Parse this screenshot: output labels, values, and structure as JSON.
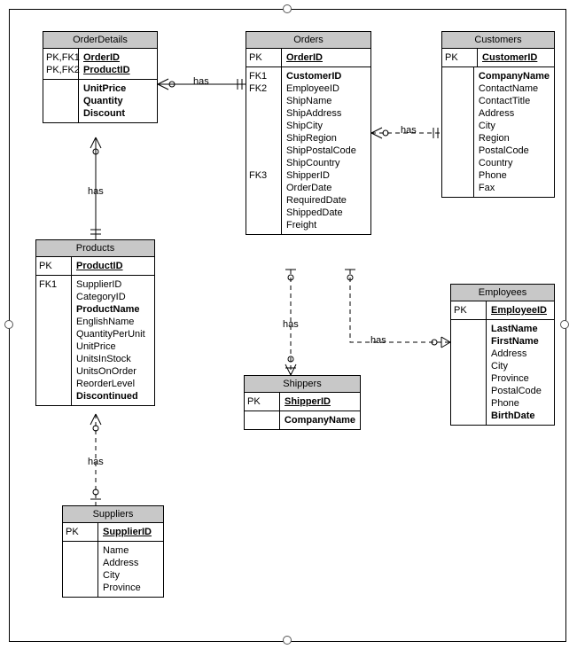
{
  "diagram": {
    "entities": {
      "orderDetails": {
        "title": "OrderDetails",
        "pk": [
          {
            "key": "PK,FK1",
            "attr": "OrderID"
          },
          {
            "key": "PK,FK2",
            "attr": "ProductID"
          }
        ],
        "body": [
          {
            "key": "",
            "attrs": [
              "UnitPrice",
              "Quantity",
              "Discount"
            ],
            "bold": [
              true,
              true,
              true
            ]
          }
        ]
      },
      "orders": {
        "title": "Orders",
        "pk": [
          {
            "key": "PK",
            "attr": "OrderID"
          }
        ],
        "body": [
          {
            "keys": [
              "FK1",
              "FK2",
              "",
              "",
              "",
              "",
              "",
              "",
              "FK3",
              "",
              "",
              "",
              ""
            ],
            "attrs": [
              "CustomerID",
              "EmployeeID",
              "ShipName",
              "ShipAddress",
              "ShipCity",
              "ShipRegion",
              "ShipPostalCode",
              "ShipCountry",
              "ShipperID",
              "OrderDate",
              "RequiredDate",
              "ShippedDate",
              "Freight"
            ],
            "bold": [
              true,
              false,
              false,
              false,
              false,
              false,
              false,
              false,
              false,
              false,
              false,
              false,
              false
            ]
          }
        ]
      },
      "customers": {
        "title": "Customers",
        "pk": [
          {
            "key": "PK",
            "attr": "CustomerID"
          }
        ],
        "body": [
          {
            "keys": [
              "",
              "",
              "",
              "",
              "",
              "",
              "",
              "",
              ""
            ],
            "attrs": [
              "CompanyName",
              "ContactName",
              "ContactTitle",
              "Address",
              "City",
              "Region",
              "PostalCode",
              "Country",
              "Phone",
              "Fax"
            ],
            "bold": [
              true,
              false,
              false,
              false,
              false,
              false,
              false,
              false,
              false,
              false
            ]
          }
        ]
      },
      "products": {
        "title": "Products",
        "pk": [
          {
            "key": "PK",
            "attr": "ProductID"
          }
        ],
        "body": [
          {
            "keys": [
              "FK1",
              "",
              "",
              "",
              "",
              "",
              "",
              "",
              "",
              ""
            ],
            "attrs": [
              "SupplierID",
              "CategoryID",
              "ProductName",
              "EnglishName",
              "QuantityPerUnit",
              "UnitPrice",
              "UnitsInStock",
              "UnitsOnOrder",
              "ReorderLevel",
              "Discontinued"
            ],
            "bold": [
              false,
              false,
              true,
              false,
              false,
              false,
              false,
              false,
              false,
              true
            ]
          }
        ]
      },
      "employees": {
        "title": "Employees",
        "pk": [
          {
            "key": "PK",
            "attr": "EmployeeID"
          }
        ],
        "body": [
          {
            "keys": [
              "",
              "",
              "",
              "",
              "",
              "",
              "",
              ""
            ],
            "attrs": [
              "LastName",
              "FirstName",
              "Address",
              "City",
              "Province",
              "PostalCode",
              "Phone",
              "BirthDate"
            ],
            "bold": [
              true,
              true,
              false,
              false,
              false,
              false,
              false,
              true
            ]
          }
        ]
      },
      "shippers": {
        "title": "Shippers",
        "pk": [
          {
            "key": "PK",
            "attr": "ShipperID"
          }
        ],
        "body": [
          {
            "keys": [
              ""
            ],
            "attrs": [
              "CompanyName"
            ],
            "bold": [
              true
            ]
          }
        ]
      },
      "suppliers": {
        "title": "Suppliers",
        "pk": [
          {
            "key": "PK",
            "attr": "SupplierID"
          }
        ],
        "body": [
          {
            "keys": [
              "",
              "",
              "",
              ""
            ],
            "attrs": [
              "Name",
              "Address",
              "City",
              "Province"
            ],
            "bold": [
              false,
              false,
              false,
              false
            ]
          }
        ]
      }
    },
    "relationships": {
      "od_orders": "has",
      "od_products": "has",
      "orders_customers": "has",
      "orders_shippers": "has",
      "orders_employees": "has",
      "products_suppliers": "has"
    }
  }
}
